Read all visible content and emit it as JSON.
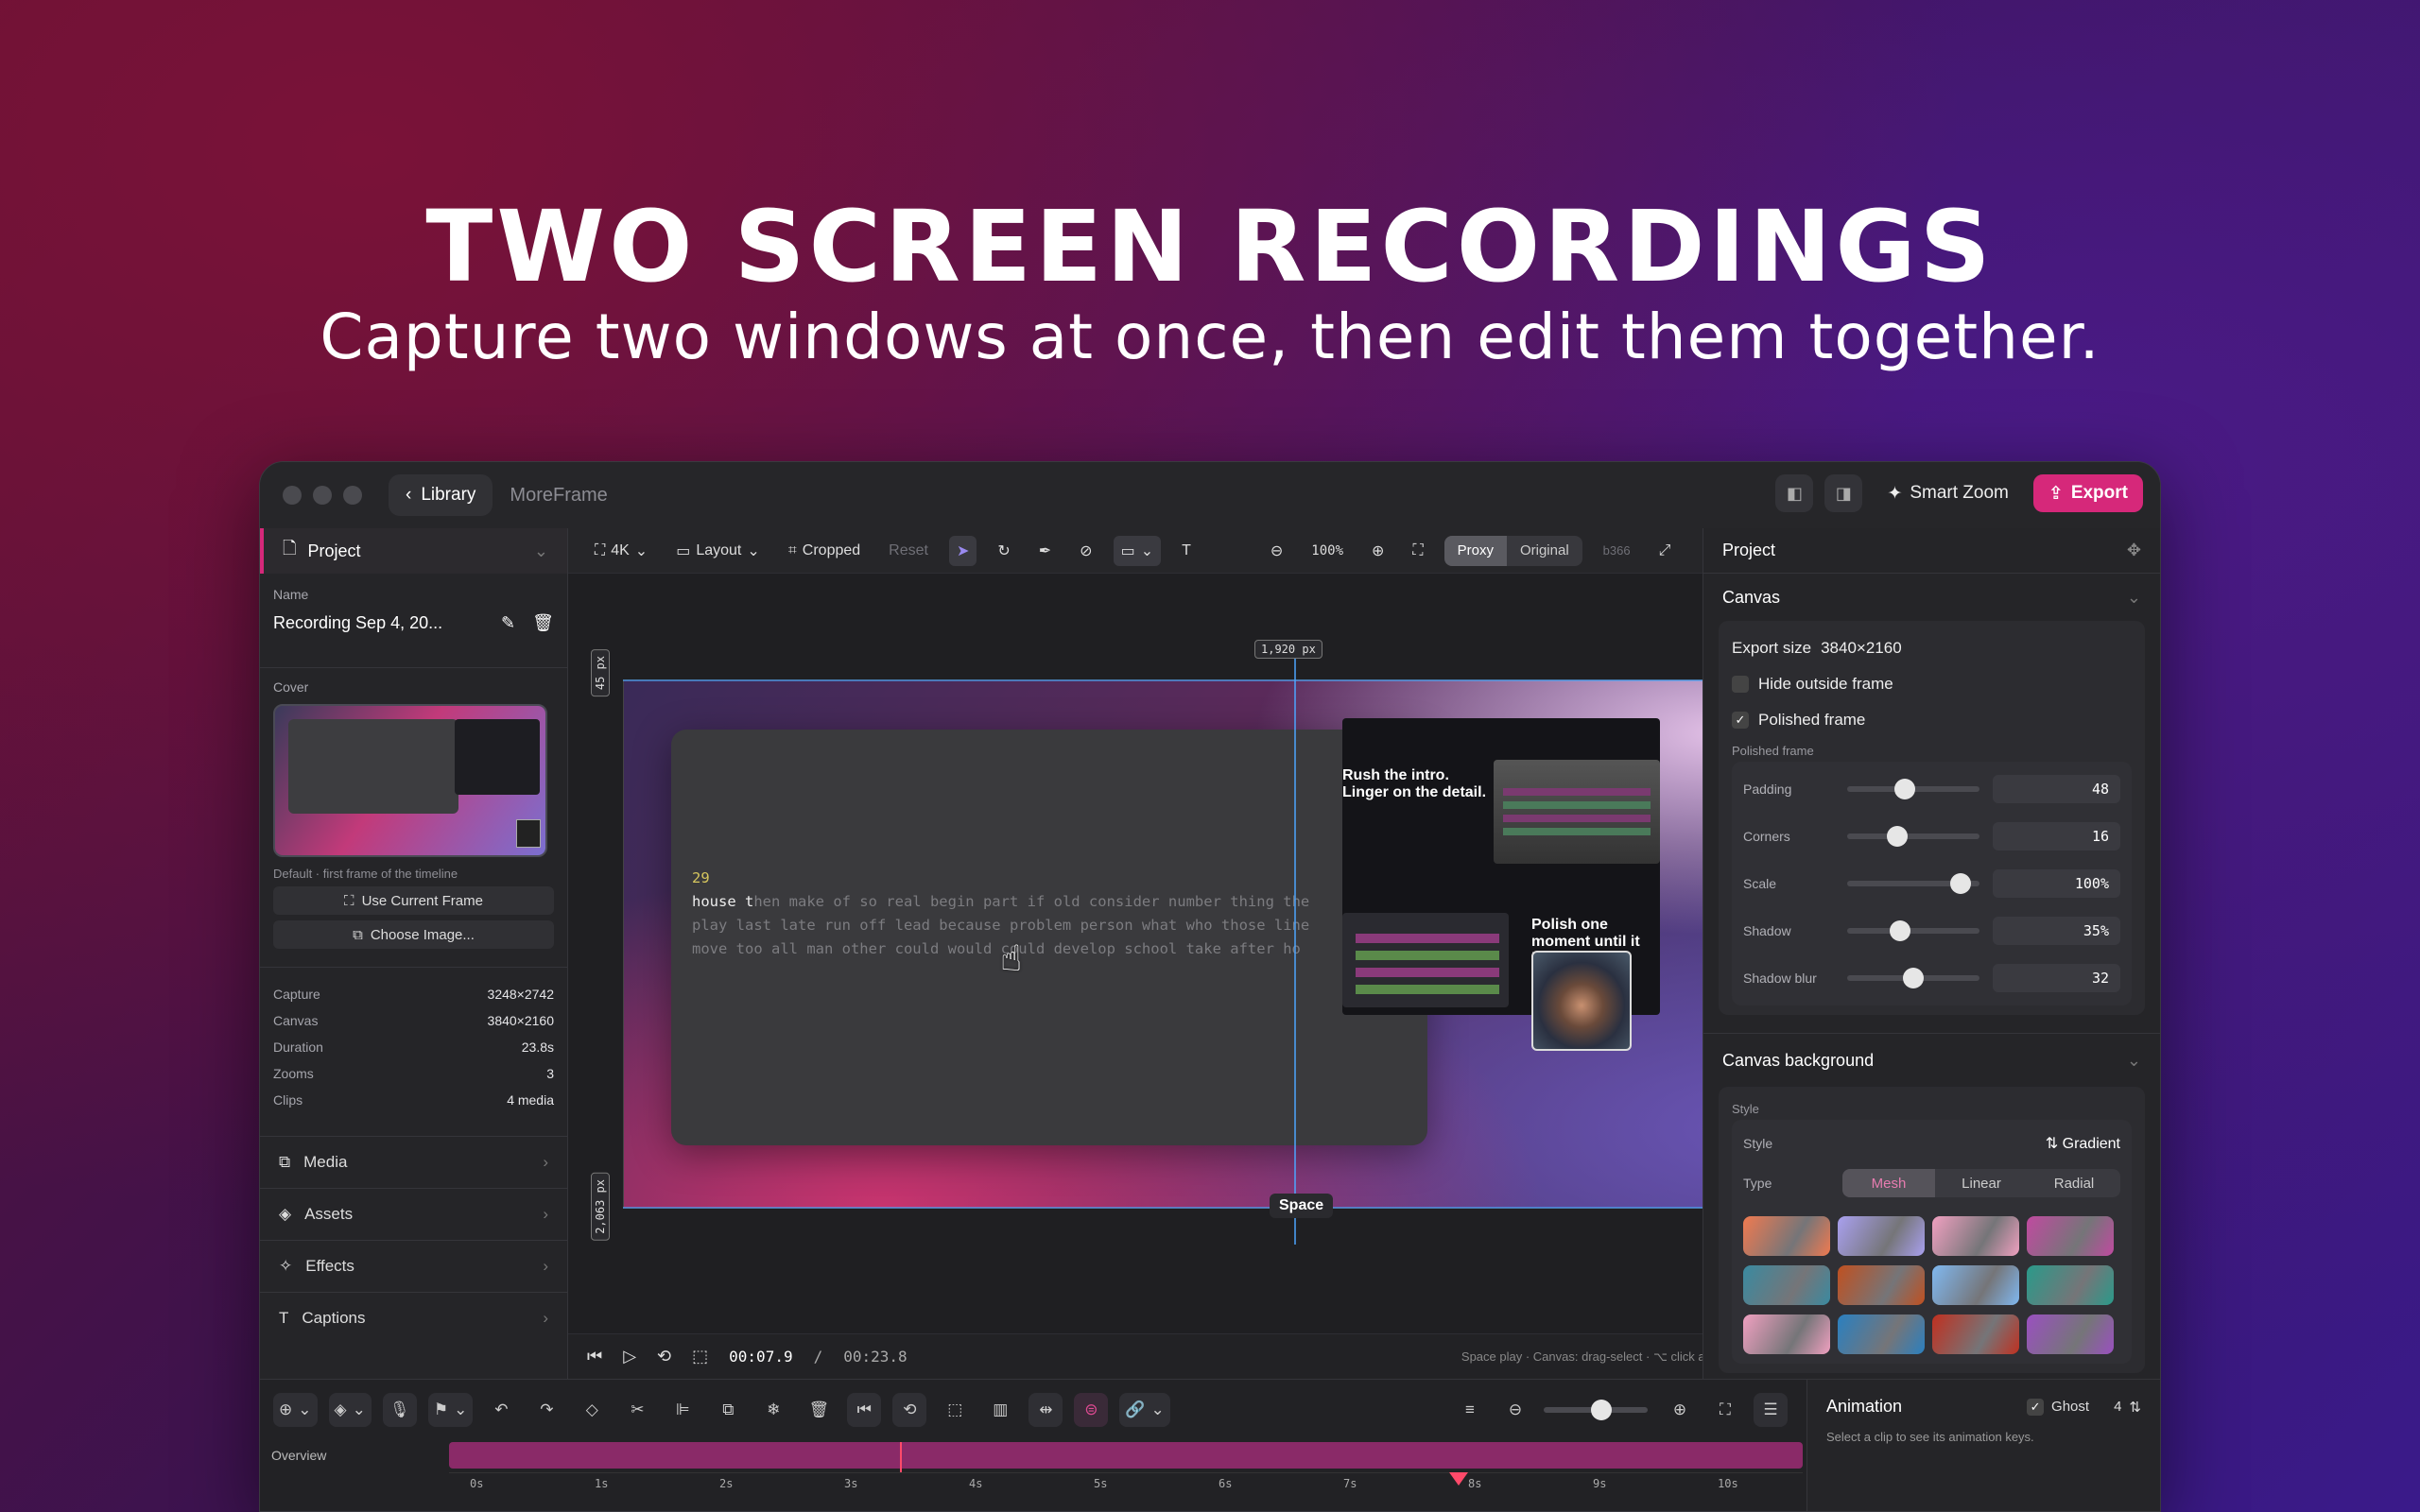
{
  "hero": {
    "title": "TWO SCREEN RECORDINGS",
    "subtitle": "Capture two windows at once, then edit them together."
  },
  "titlebar": {
    "library_label": "Library",
    "app_name": "MoreFrame",
    "smart_zoom_label": "Smart Zoom",
    "export_label": "Export"
  },
  "left": {
    "header": "Project",
    "name_label": "Name",
    "name_value": "Recording Sep 4, 20...",
    "cover_label": "Cover",
    "cover_hint": "Default · first frame of the timeline",
    "use_current_frame": "Use Current Frame",
    "choose_image": "Choose Image...",
    "stats": [
      {
        "label": "Capture",
        "value": "3248×2742"
      },
      {
        "label": "Canvas",
        "value": "3840×2160"
      },
      {
        "label": "Duration",
        "value": "23.8s"
      },
      {
        "label": "Zooms",
        "value": "3"
      },
      {
        "label": "Clips",
        "value": "4 media"
      }
    ],
    "nav": [
      "Media",
      "Assets",
      "Effects",
      "Captions"
    ]
  },
  "toolbar": {
    "resolution": "4K",
    "layout": "Layout",
    "cropped": "Cropped",
    "reset": "Reset",
    "zoom": "100%",
    "proxy": "Proxy",
    "original": "Original",
    "b366": "b366"
  },
  "canvas": {
    "width_tag": "1,920 px",
    "top_tag": "45 px",
    "bottom_tag": "2,063 px",
    "space_tag": "Space",
    "code_line_no": "29",
    "code_line1_typed": "house t",
    "code_line1_ghost": "hen make of so real begin part if old consider number thing the",
    "code_line2": "play last late run off lead because problem person what who those line",
    "code_line3": "move too all man other could would could develop school take after ho",
    "web_heading1": "Rush the intro. Linger on the detail.",
    "web_heading2": "Polish one moment until it lands."
  },
  "transport": {
    "current": "00:07.9",
    "separator": "/",
    "total": "00:23.8",
    "hint": "Space play · Canvas: drag-select · ⌥ click add · R rotate · ⇧H/⇧V flip · Z zoom · B split"
  },
  "right": {
    "header": "Project",
    "canvas_section": "Canvas",
    "export_size_label": "Export size",
    "export_size_value": "3840×2160",
    "hide_outside": "Hide outside frame",
    "polished_frame": "Polished frame",
    "polished_frame_sub": "Polished frame",
    "sliders": [
      {
        "label": "Padding",
        "value": "48",
        "level": 0.42
      },
      {
        "label": "Corners",
        "value": "16",
        "level": 0.36
      },
      {
        "label": "Scale",
        "value": "100%",
        "level": 0.92
      },
      {
        "label": "Shadow",
        "value": "35%",
        "level": 0.38
      },
      {
        "label": "Shadow blur",
        "value": "32",
        "level": 0.5
      }
    ],
    "bg_section": "Canvas background",
    "style_group": "Style",
    "style_label": "Style",
    "style_value": "Gradient",
    "type_label": "Type",
    "types": [
      "Mesh",
      "Linear",
      "Radial"
    ],
    "swatch_colors": [
      "#f07a50",
      "#a9a0ef",
      "#f0a0c0",
      "#c04aa0",
      "#3a8aa0",
      "#c05020",
      "#80b8f0",
      "#2a9a8a",
      "#f0a0c0",
      "#2a80c0",
      "#c03020",
      "#9a50c0"
    ]
  },
  "bottom": {
    "overview_label": "Overview",
    "ticks": [
      "0s",
      "1s",
      "2s",
      "3s",
      "4s",
      "5s",
      "6s",
      "7s",
      "8s",
      "9s",
      "10s"
    ],
    "animation_title": "Animation",
    "ghost_label": "Ghost",
    "ghost_value": "4",
    "animation_hint": "Select a clip to see its animation keys."
  }
}
